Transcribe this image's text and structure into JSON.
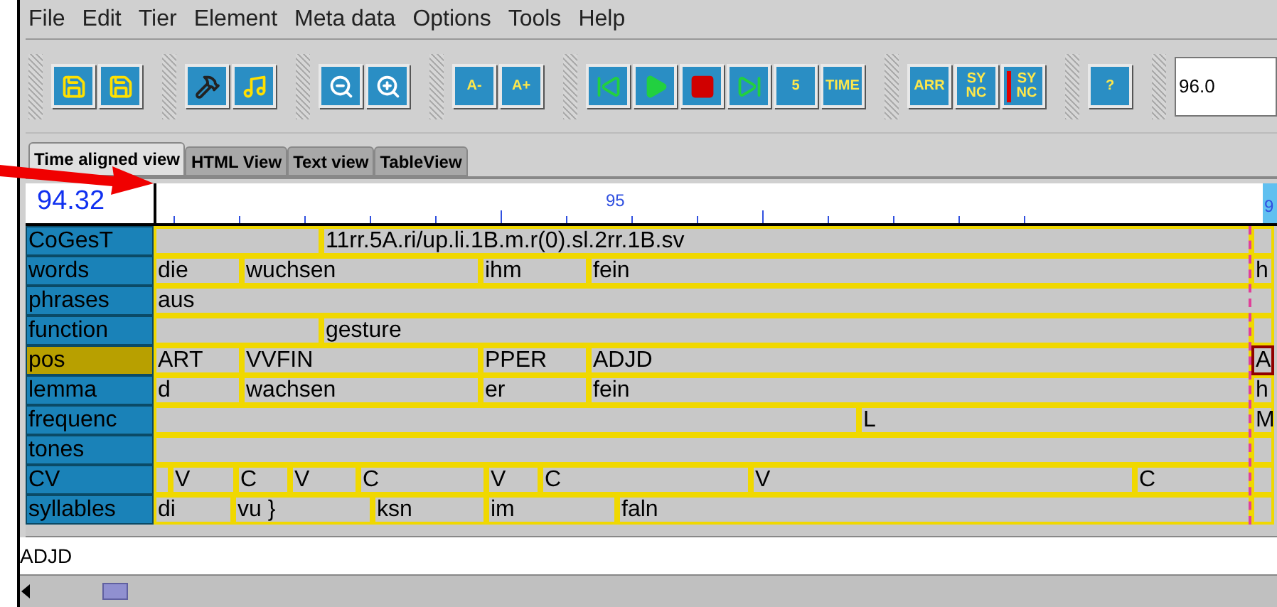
{
  "menu": [
    "File",
    "Edit",
    "Tier",
    "Element",
    "Meta data",
    "Options",
    "Tools",
    "Help"
  ],
  "toolbar": [
    [
      {
        "kind": "icon"
      },
      {
        "kind": "icon"
      }
    ],
    [
      {
        "kind": "icon"
      },
      {
        "kind": "icon"
      }
    ],
    [
      {
        "kind": "icon"
      },
      {
        "kind": "icon"
      }
    ],
    [
      {
        "kind": "text",
        "label": "A-"
      },
      {
        "kind": "text",
        "label": "A+"
      }
    ],
    [
      {
        "kind": "icon"
      },
      {
        "kind": "icon"
      },
      {
        "kind": "icon"
      },
      {
        "kind": "icon"
      },
      {
        "kind": "text",
        "label": "5"
      },
      {
        "kind": "text",
        "label": "TIME"
      }
    ],
    [
      {
        "kind": "text",
        "label": "ARR"
      },
      {
        "kind": "text",
        "label": "SY NC"
      },
      {
        "kind": "marked",
        "label": "SY NC"
      }
    ],
    [
      {
        "kind": "text",
        "label": "?"
      }
    ]
  ],
  "time_field": "96.0",
  "tabs": [
    {
      "label": "Time aligned view",
      "selected": true
    },
    {
      "label": "HTML View",
      "selected": false
    },
    {
      "label": "Text view",
      "selected": false
    },
    {
      "label": "TableView",
      "selected": false
    }
  ],
  "current_time": "94.32",
  "ruler": {
    "label": "95",
    "right_label": "9"
  },
  "tiers": [
    {
      "name": "CoGesT",
      "selected": false,
      "segments": [
        {
          "selected": false
        },
        {
          "text": "11rr.5A.ri/up.li.1B.m.r(0).sl.2rr.1B.sv",
          "selected": false
        },
        {
          "selected": false
        }
      ]
    },
    {
      "name": "words",
      "selected": false,
      "segments": [
        {
          "text": "die",
          "selected": false
        },
        {
          "text": "wuchsen",
          "selected": false
        },
        {
          "text": "ihm",
          "selected": false
        },
        {
          "text": "fein",
          "selected": false
        },
        {
          "text": "h",
          "selected": false
        }
      ]
    },
    {
      "name": "phrases",
      "selected": false,
      "segments": [
        {
          "text": "aus",
          "selected": false
        }
      ]
    },
    {
      "name": "function",
      "selected": false,
      "segments": [
        {
          "selected": false
        },
        {
          "text": "gesture",
          "selected": false
        },
        {
          "selected": false
        }
      ]
    },
    {
      "name": "pos",
      "selected": true,
      "segments": [
        {
          "text": "ART",
          "selected": false
        },
        {
          "text": "VVFIN",
          "selected": false
        },
        {
          "text": "PPER",
          "selected": false
        },
        {
          "text": "ADJD",
          "selected": false
        },
        {
          "text": "A",
          "selected": true
        }
      ]
    },
    {
      "name": "lemma",
      "selected": false,
      "segments": [
        {
          "text": "d",
          "selected": false
        },
        {
          "text": "wachsen",
          "selected": false
        },
        {
          "text": "er",
          "selected": false
        },
        {
          "text": "fein",
          "selected": false
        },
        {
          "text": "h",
          "selected": false
        }
      ]
    },
    {
      "name": "frequenc",
      "selected": false,
      "segments": [
        {
          "selected": false
        },
        {
          "text": "L",
          "selected": false
        },
        {
          "text": "M",
          "selected": false
        }
      ]
    },
    {
      "name": "tones",
      "selected": false,
      "segments": [
        {
          "selected": false
        },
        {
          "selected": false
        }
      ]
    },
    {
      "name": "CV",
      "selected": false,
      "segments": [
        {
          "selected": false
        },
        {
          "text": "V",
          "selected": false
        },
        {
          "text": "C",
          "selected": false
        },
        {
          "text": "V",
          "selected": false
        },
        {
          "text": "C",
          "selected": false
        },
        {
          "text": "V",
          "selected": false
        },
        {
          "text": "C",
          "selected": false
        },
        {
          "text": "V",
          "selected": false
        },
        {
          "text": "C",
          "selected": false
        },
        {
          "selected": false
        }
      ]
    },
    {
      "name": "syllables",
      "selected": false,
      "segments": [
        {
          "text": "di",
          "selected": false
        },
        {
          "text": "vu }",
          "selected": false
        },
        {
          "text": "ksn",
          "selected": false
        },
        {
          "text": "im",
          "selected": false
        },
        {
          "text": "faln",
          "selected": false
        },
        {
          "selected": false
        }
      ]
    }
  ],
  "status": "ADJD"
}
